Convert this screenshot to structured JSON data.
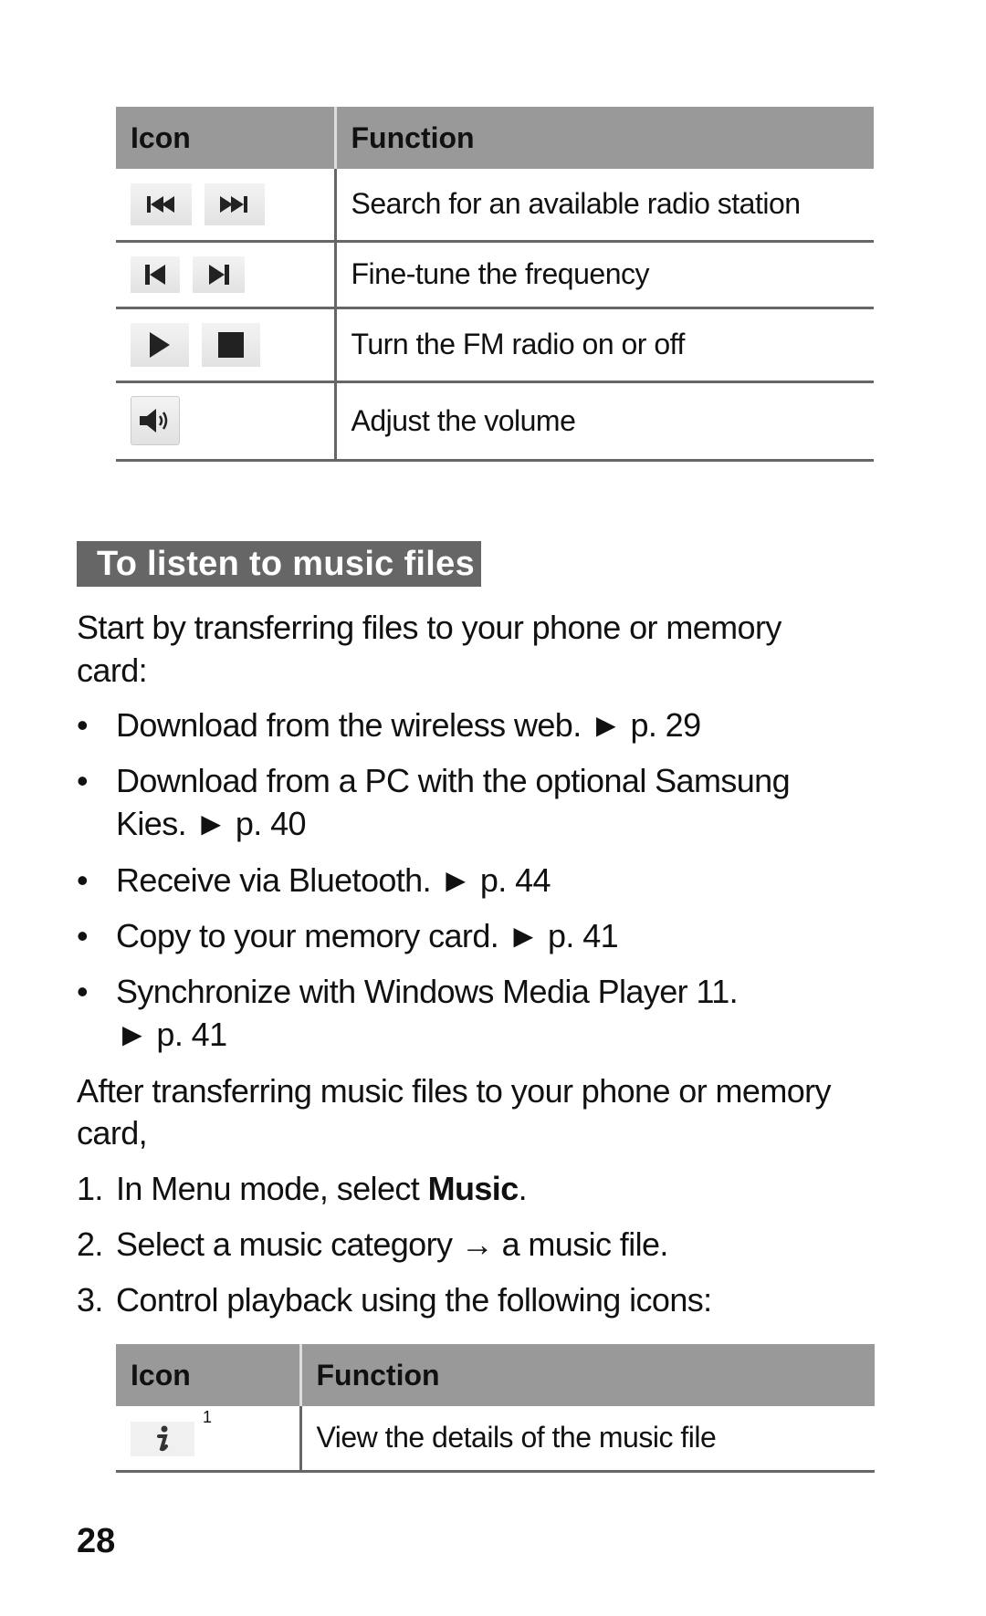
{
  "radio_table": {
    "headers": [
      "Icon",
      "Function"
    ],
    "rows": [
      {
        "icons": [
          "rewind-icon",
          "fast-forward-icon"
        ],
        "function": "Search for an available radio station"
      },
      {
        "icons": [
          "skip-back-icon",
          "skip-forward-icon"
        ],
        "function": "Fine-tune the frequency"
      },
      {
        "icons": [
          "play-icon",
          "stop-icon"
        ],
        "function": "Turn the FM radio on or off"
      },
      {
        "icons": [
          "volume-icon"
        ],
        "function": "Adjust the volume"
      }
    ]
  },
  "section": {
    "heading": "To listen to music files",
    "intro_line1": "Start by transferring files to your phone or memory",
    "intro_line2": "card:",
    "bullet_glyph": "•",
    "ref_arrow": "►",
    "bullets": [
      {
        "line1": "Download from the wireless web. ► p. 29",
        "line2": ""
      },
      {
        "line1": "Download from a PC with the optional Samsung",
        "line2": "Kies. ► p. 40"
      },
      {
        "line1": "Receive via Bluetooth. ► p. 44",
        "line2": ""
      },
      {
        "line1": "Copy to your memory card. ► p. 41",
        "line2": ""
      },
      {
        "line1": "Synchronize with Windows Media Player 11.",
        "line2": "► p. 41"
      }
    ],
    "after_line1": "After transferring music files to your phone or memory",
    "after_line2": "card,",
    "steps": [
      {
        "num": "1.",
        "pre": "In Menu mode, select ",
        "bold": "Music",
        "post": "."
      },
      {
        "num": "2.",
        "pre": "Select a music category → a music file.",
        "bold": "",
        "post": ""
      },
      {
        "num": "3.",
        "pre": "Control playback using the following icons:",
        "bold": "",
        "post": ""
      }
    ]
  },
  "music_table": {
    "headers": [
      "Icon",
      "Function"
    ],
    "rows": [
      {
        "icons": [
          "info-icon"
        ],
        "footnote": "1",
        "function": "View the details of the music file"
      }
    ]
  },
  "page_number": "28"
}
